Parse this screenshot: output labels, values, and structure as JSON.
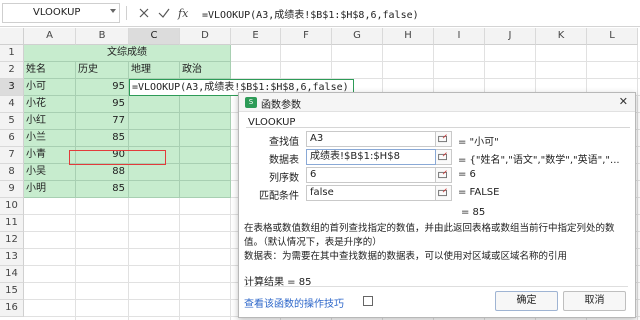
{
  "formula_bar": {
    "name_box": "VLOOKUP",
    "formula": "=VLOOKUP(A3,成绩表!$B$1:$H$8,6,false)"
  },
  "columns": [
    "A",
    "B",
    "C",
    "D",
    "E",
    "F",
    "G",
    "H",
    "I",
    "J",
    "K",
    "L"
  ],
  "rows": [
    "1",
    "2",
    "3",
    "4",
    "5",
    "6",
    "7",
    "8",
    "9",
    "10",
    "11",
    "12",
    "13",
    "14",
    "15",
    "16"
  ],
  "sheet": {
    "title": "文综成绩",
    "headers": [
      "姓名",
      "历史",
      "地理",
      "政治"
    ],
    "data": [
      [
        "小可",
        "95"
      ],
      [
        "小花",
        "95"
      ],
      [
        "小红",
        "77"
      ],
      [
        "小兰",
        "85"
      ],
      [
        "小青",
        "90"
      ],
      [
        "小吴",
        "88"
      ],
      [
        "小明",
        "85"
      ]
    ],
    "editing_cell": "=VLOOKUP(A3,成绩表!$B$1:$H$8,6,false)"
  },
  "dialog": {
    "title": "函数参数",
    "group": "VLOOKUP",
    "args": [
      {
        "label": "查找值",
        "value": "A3",
        "result": "= \"小可\""
      },
      {
        "label": "数据表",
        "value": "成绩表!$B$1:$H$8",
        "result": "= {\"姓名\",\"语文\",\"数学\",\"英语\",\"..."
      },
      {
        "label": "列序数",
        "value": "6",
        "result": "= 6"
      },
      {
        "label": "匹配条件",
        "value": "false",
        "result": "= FALSE"
      }
    ],
    "result": "= 85",
    "description": "在表格或数值数组的首列查找指定的数值，并由此返回表格或数组当前行中指定列处的数值。（默认情况下，表是升序的）",
    "param_description": "数据表：为需要在其中查找数据的数据表，可以使用对区域或区域名称的引用",
    "calc_result": "计算结果 = 85",
    "tips_link": "查看该函数的操作技巧",
    "ok": "确定",
    "cancel": "取消"
  },
  "colors": {
    "header_green": "#2d9b57",
    "data_green": "#c7ecce",
    "highlight_red": "#e23b3b",
    "link_blue": "#2c66c9"
  }
}
